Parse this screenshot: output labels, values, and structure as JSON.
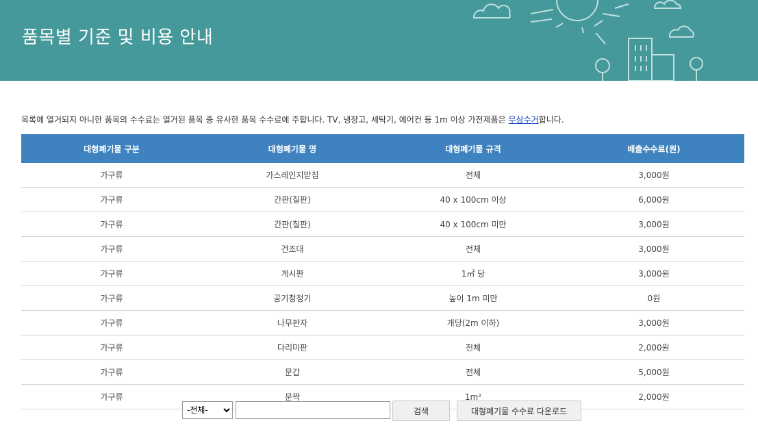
{
  "header": {
    "title": "품목별 기준 및 비용 안내"
  },
  "notice": {
    "text_before": "목록에 열거되지 아니한 품목의 수수료는 열거된 품목 중 유사한 품목 수수료에 주합니다. TV, 냉장고, 세탁기, 에어컨 등 1m 이상 가전제품은 ",
    "link": "무상수거",
    "text_after": "합니다."
  },
  "table": {
    "headers": [
      "대형폐기물 구분",
      "대형폐기물 명",
      "대형폐기물 규격",
      "배출수수료(원)"
    ],
    "rows": [
      [
        "가구류",
        "가스레인지받침",
        "전체",
        "3,000원"
      ],
      [
        "가구류",
        "간판(칠판)",
        "40 x 100cm 이상",
        "6,000원"
      ],
      [
        "가구류",
        "간판(칠판)",
        "40 x 100cm 미만",
        "3,000원"
      ],
      [
        "가구류",
        "건조대",
        "전체",
        "3,000원"
      ],
      [
        "가구류",
        "게시판",
        "1㎡ 당",
        "3,000원"
      ],
      [
        "가구류",
        "공기청정기",
        "높이 1m 미만",
        "0원"
      ],
      [
        "가구류",
        "나무판자",
        "개당(2m 이하)",
        "3,000원"
      ],
      [
        "가구류",
        "다리미판",
        "전체",
        "2,000원"
      ],
      [
        "가구류",
        "문갑",
        "전체",
        "5,000원"
      ],
      [
        "가구류",
        "문짝",
        "1m²",
        "2,000원"
      ]
    ]
  },
  "search": {
    "category_selected": "-전체-",
    "query_value": "",
    "search_label": "검색",
    "download_label": "대형폐기물 수수료 다운로드"
  },
  "colors": {
    "banner": "#46999a",
    "table_header": "#3e82bf"
  }
}
